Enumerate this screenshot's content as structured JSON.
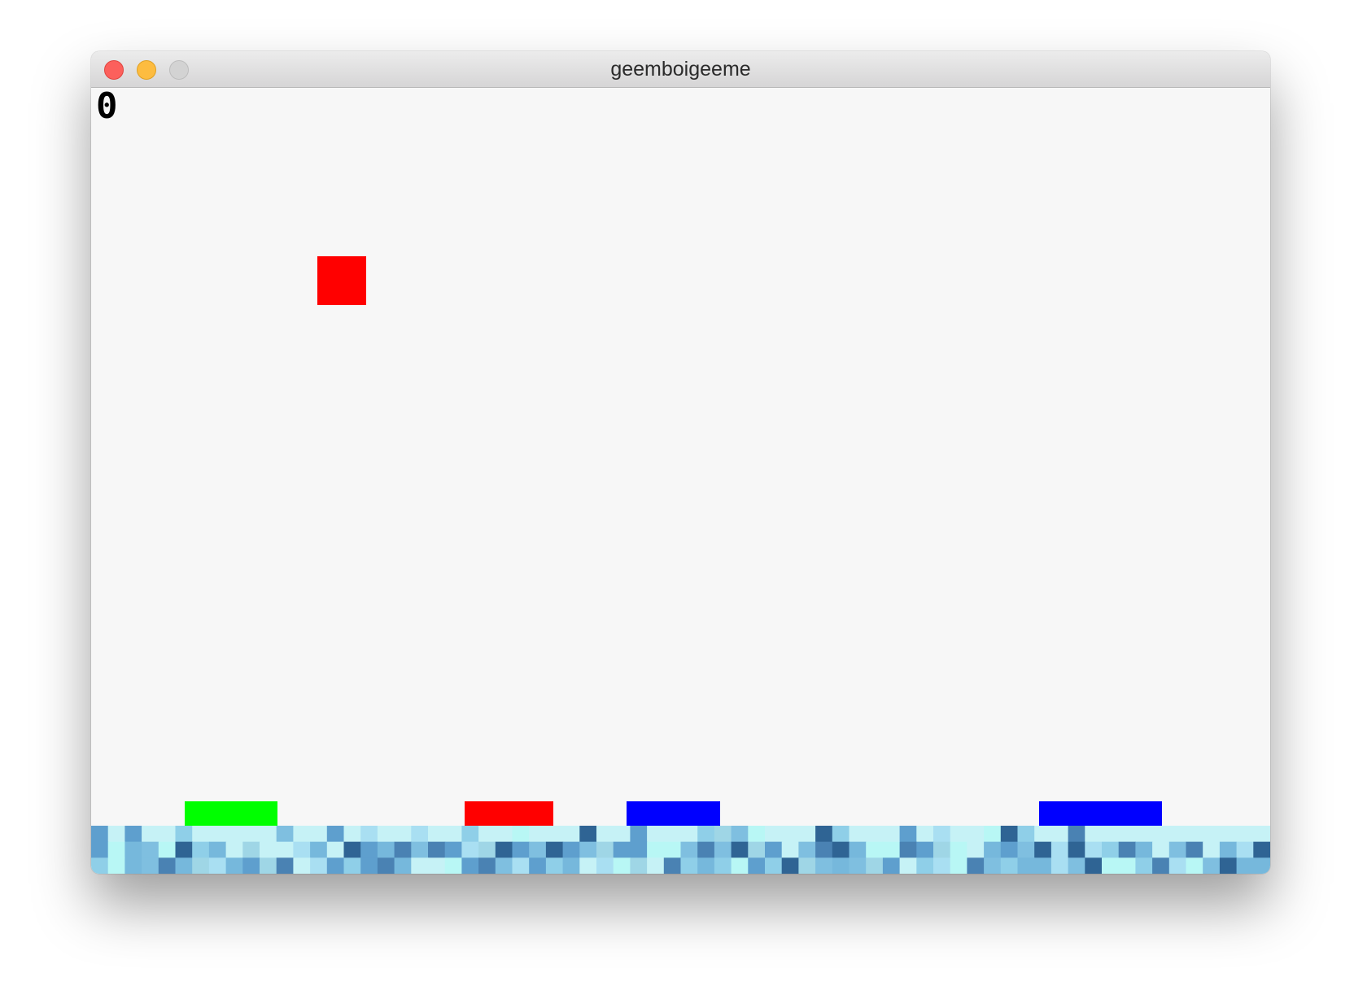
{
  "window": {
    "title": "geemboigeeme"
  },
  "game": {
    "score": "0",
    "falling_block": {
      "color": "#ff0000"
    },
    "platforms": [
      {
        "name": "green-platform",
        "color": "#00ff00"
      },
      {
        "name": "red-platform",
        "color": "#ff0000"
      },
      {
        "name": "blue-platform",
        "color": "#0000ff"
      },
      {
        "name": "blue-platform",
        "color": "#0000ff"
      }
    ],
    "ground": {
      "palette": [
        "#c6f2f6",
        "#a9dff2",
        "#8fcfe8",
        "#76b8dc",
        "#5e9fce",
        "#4a82b3",
        "#2f6494",
        "#b8f7f5",
        "#9fd6e6",
        "#7fbfe0"
      ]
    }
  }
}
